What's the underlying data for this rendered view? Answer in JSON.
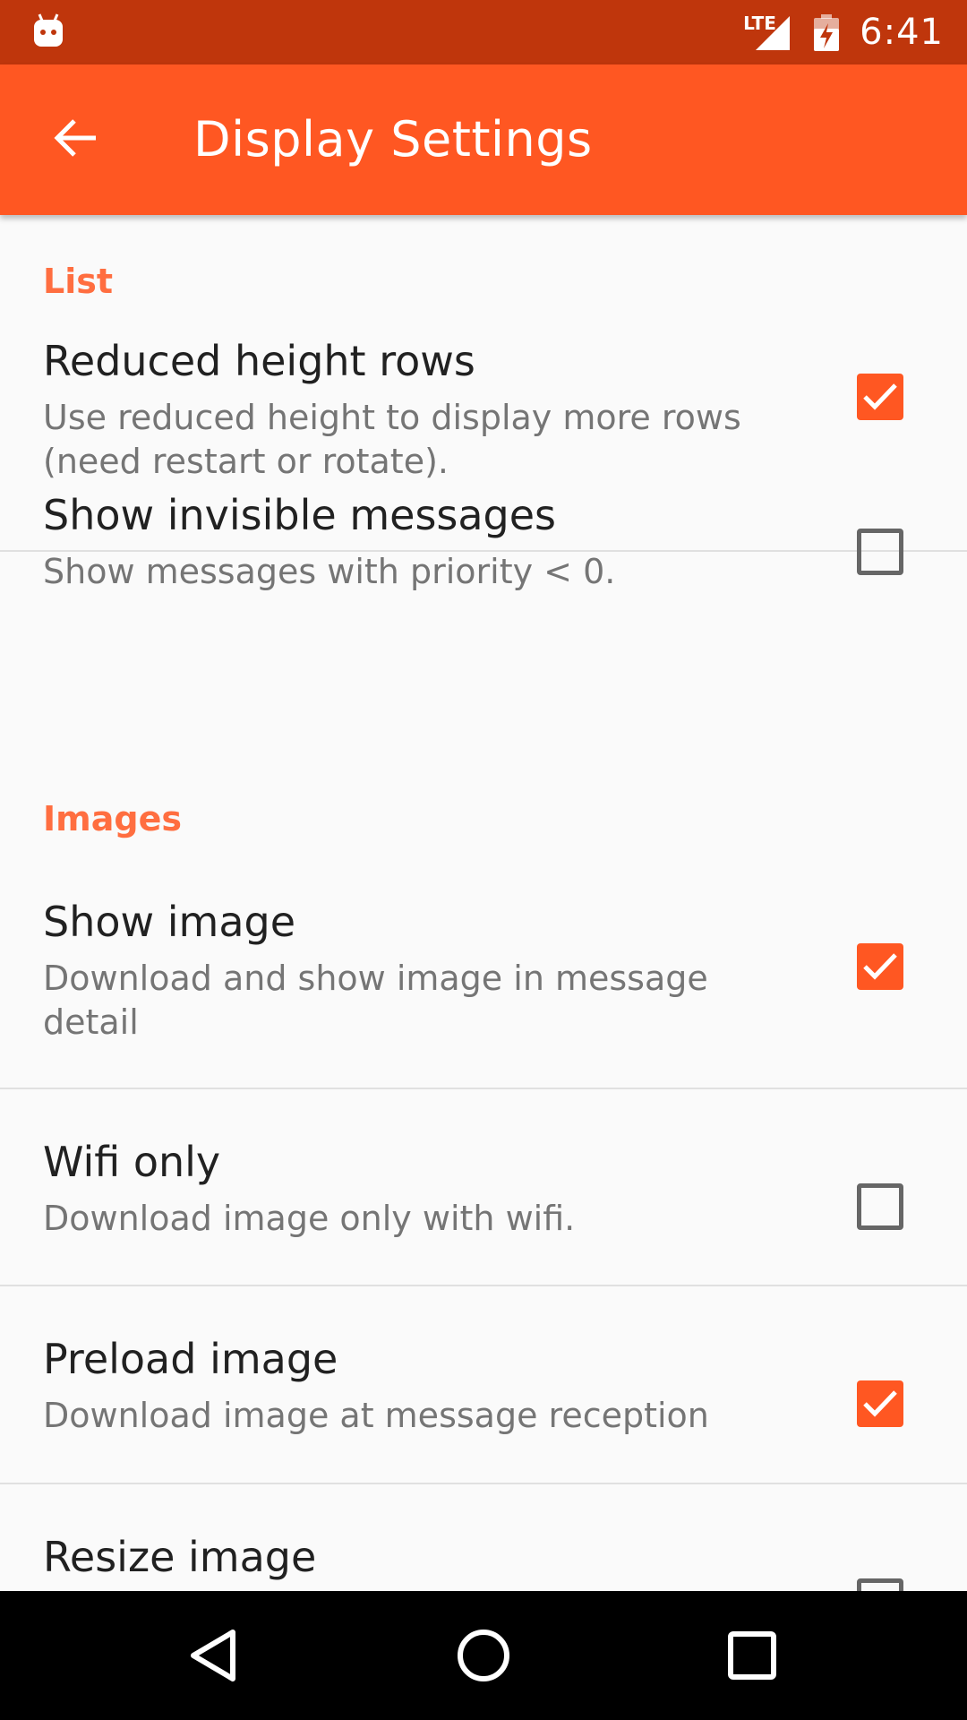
{
  "status_bar": {
    "time": "6:41",
    "network": "LTE",
    "notification_icon": "android-robot-icon"
  },
  "toolbar": {
    "title": "Display Settings",
    "back_icon": "back-arrow-icon"
  },
  "sections": [
    {
      "header": "List",
      "prefs": [
        {
          "title": "Reduced height rows",
          "summary": "Use reduced height to display more rows (need restart or rotate).",
          "checked": true
        },
        {
          "title": "Show invisible messages",
          "summary": "Show messages with priority < 0.",
          "checked": false
        }
      ]
    },
    {
      "header": "Images",
      "prefs": [
        {
          "title": "Show image",
          "summary": "Download and show image in message detail",
          "checked": true
        },
        {
          "title": "Wifi only",
          "summary": "Download image only with wifi.",
          "checked": false
        },
        {
          "title": "Preload image",
          "summary": "Download image at message reception",
          "checked": true
        },
        {
          "title": "Resize image",
          "summary": "",
          "checked": false
        }
      ]
    }
  ],
  "colors": {
    "status_bar": "#BF360C",
    "toolbar": "#FF5722",
    "accent": "#FF6E40",
    "background": "#FAFAFA"
  },
  "nav_bar": {
    "back_icon": "nav-back-icon",
    "home_icon": "nav-home-icon",
    "recents_icon": "nav-recents-icon"
  }
}
